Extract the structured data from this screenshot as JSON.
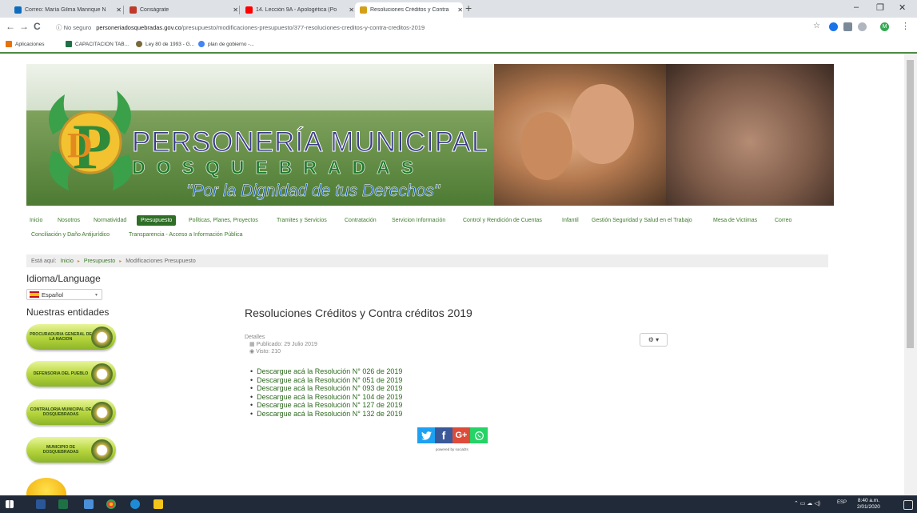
{
  "tabs": [
    {
      "label": "Correo: María Gilma Manrique N",
      "favicon_color": "#0f6cbd",
      "active": false
    },
    {
      "label": "Conságrate",
      "favicon_color": "#c0392b",
      "active": false
    },
    {
      "label": "14. Lección 9A - Apologética (Po",
      "favicon_color": "#ff0000",
      "active": false
    },
    {
      "label": "Resoluciones Créditos y Contra",
      "favicon_color": "#d4a017",
      "active": true
    }
  ],
  "new_tab_label": "+",
  "window_controls": {
    "minimize": "–",
    "maximize": "❐",
    "close": "✕"
  },
  "toolbar": {
    "back": "←",
    "forward": "→",
    "reload": "C",
    "not_secure": "ⓘ No seguro",
    "url_domain": "personeriadosquebradas.gov.co",
    "url_path": "/presupuesto/modificaciones-presupuesto/377-resoluciones-creditos-y-contra-creditos-2019",
    "star": "☆",
    "menu": "⋮",
    "avatar": "M"
  },
  "bookmarks": [
    {
      "label": "Aplicaciones",
      "icon_color": "#e8710a"
    },
    {
      "label": "CAPACITACION TAB...",
      "icon_color": "#1e7145"
    },
    {
      "label": "Ley 80 de 1993 - G...",
      "icon_color": "#7a6a3a"
    },
    {
      "label": "plan de gobierno -...",
      "icon_color": "#4285f4"
    }
  ],
  "banner": {
    "title_line1": "PERSONERÍA MUNICIPAL",
    "title_line2": "DOSQUEBRADAS",
    "slogan": "\"Por la Dignidad de tus Derechos\""
  },
  "menu": [
    {
      "label": "Inicio",
      "active": false
    },
    {
      "label": "Nosotros",
      "active": false
    },
    {
      "label": "Normatividad",
      "active": false
    },
    {
      "label": "Presupuesto",
      "active": true
    },
    {
      "label": "Políticas, Planes, Proyectos",
      "active": false
    },
    {
      "label": "Tramites y Servicios",
      "active": false
    },
    {
      "label": "Contratación",
      "active": false
    },
    {
      "label": "Servicion Información",
      "active": false
    },
    {
      "label": "Control y Rendición de Cuentas",
      "active": false
    },
    {
      "label": "Infantil",
      "active": false
    },
    {
      "label": "Gestión Seguridad y Salud en el Trabajo",
      "active": false
    },
    {
      "label": "Mesa de Victimas",
      "active": false
    },
    {
      "label": "Correo",
      "active": false
    },
    {
      "label": "Conciliación y Daño Antijurídico",
      "active": false
    },
    {
      "label": "Transparencia - Acceso a Información Pública",
      "active": false
    }
  ],
  "breadcrumb": {
    "prefix": "Está aquí:",
    "items": [
      "Inicio",
      "Presupuesto",
      "Modificaciones Presupuesto"
    ]
  },
  "sidebar": {
    "language_heading": "Idioma/Language",
    "language_value": "Español",
    "entities_heading": "Nuestras entidades",
    "entities": [
      {
        "label": "PROCURADURIA GENERAL DE LA NACION"
      },
      {
        "label": "DEFENSORIA DEL PUEBLO"
      },
      {
        "label": "CONTRALORIA MUNICIPAL DE DOSQUEBRADAS"
      },
      {
        "label": "MUNICIPIO DE DOSQUEBRADAS"
      }
    ]
  },
  "article": {
    "title": "Resoluciones Créditos y Contra créditos 2019",
    "details_label": "Detalles",
    "published": "Publicado: 29 Julio 2019",
    "views": "Visto: 210",
    "tools_button": "⚙ ▾",
    "downloads": [
      "Descargue acá la Resolución N° 026 de 2019",
      "Descargue acá la Resolución N° 051 de 2019",
      "Descargue acá la Resolución N° 093 de 2019",
      "Descargue acá la Resolución N° 104 de 2019",
      "Descargue acá la Resolución N° 127 de 2019",
      "Descargue acá la Resolución N° 132 de 2019"
    ],
    "social": [
      {
        "name": "twitter-icon",
        "glyph": "🐦︎",
        "color": "#1da1f2"
      },
      {
        "name": "facebook-icon",
        "glyph": "f",
        "color": "#3b5998"
      },
      {
        "name": "google-plus-icon",
        "glyph": "G+",
        "color": "#dd4b39"
      },
      {
        "name": "whatsapp-icon",
        "glyph": "✆",
        "color": "#25d366"
      }
    ],
    "powered_by": "powered by social2s"
  },
  "taskbar": {
    "lang": "ESP",
    "time": "8:40 a.m.",
    "date": "2/01/2020"
  }
}
